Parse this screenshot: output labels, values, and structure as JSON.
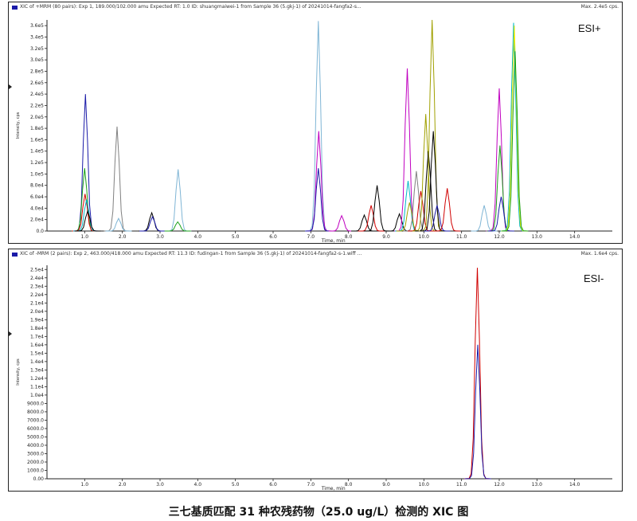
{
  "caption": "三七基质匹配 31 种农残药物（25.0 ug/L）检测的 XIC 图",
  "colors": {
    "axis": "#222222",
    "palette": [
      "#1a1aa8",
      "#d00000",
      "#18a018",
      "#00b7c8",
      "#c000c0",
      "#808080",
      "#000000",
      "#a0a000",
      "#7fb5d5",
      "#e8e800",
      "#5050ff",
      "#ff66cc"
    ]
  },
  "chart_data": [
    {
      "type": "line",
      "header": "XIC of +MRM (80 pairs): Exp 1, 189.000/102.000 amu Expected RT: 1.0 ID: shuangmaiwei-1 from Sample 36 (5.gkj-1) of 20241014-fangfa2-s...",
      "max_label": "Max. 2.4e5 cps.",
      "mode_label": "ESI+",
      "xlabel": "Time, min",
      "ylabel": "Intensity, cps",
      "xlim": [
        0,
        15.0
      ],
      "ylim": [
        0,
        370000
      ],
      "x_ticks": [
        1.0,
        2.0,
        3.0,
        4.0,
        5.0,
        6.0,
        7.0,
        8.0,
        9.0,
        10.0,
        11.0,
        12.0,
        13.0,
        14.0
      ],
      "x_tick_labels": [
        "1.0",
        "2.0",
        "3.0",
        "4.0",
        "5.0",
        "6.0",
        "7.0",
        "8.0",
        "9.0",
        "10.0",
        "11.0",
        "12.0",
        "13.0",
        "14.0"
      ],
      "y_ticks": [
        0,
        20000,
        40000,
        60000,
        80000,
        100000,
        120000,
        140000,
        160000,
        180000,
        200000,
        220000,
        240000,
        260000,
        280000,
        300000,
        320000,
        340000,
        360000
      ],
      "y_tick_labels": [
        "0.0",
        "2.0e4",
        "4.0e4",
        "6.0e4",
        "8.0e4",
        "1.0e5",
        "1.2e5",
        "1.4e5",
        "1.6e5",
        "1.8e5",
        "2.0e5",
        "2.2e5",
        "2.4e5",
        "2.6e5",
        "2.8e5",
        "3.0e5",
        "3.2e5",
        "3.4e5",
        "3.6e5"
      ],
      "peaks": [
        {
          "rt": 1.02,
          "height": 240000,
          "color": 0
        },
        {
          "rt": 1.0,
          "height": 110000,
          "color": 2
        },
        {
          "rt": 1.01,
          "height": 65000,
          "color": 1
        },
        {
          "rt": 1.05,
          "height": 55000,
          "color": 3
        },
        {
          "rt": 1.08,
          "height": 35000,
          "color": 6
        },
        {
          "rt": 1.86,
          "height": 183000,
          "color": 5
        },
        {
          "rt": 1.9,
          "height": 22000,
          "color": 8
        },
        {
          "rt": 2.78,
          "height": 32000,
          "color": 6
        },
        {
          "rt": 2.8,
          "height": 25000,
          "color": 0
        },
        {
          "rt": 3.48,
          "height": 108000,
          "color": 8
        },
        {
          "rt": 3.47,
          "height": 16000,
          "color": 2
        },
        {
          "rt": 7.2,
          "height": 368000,
          "color": 8
        },
        {
          "rt": 7.21,
          "height": 175000,
          "color": 4
        },
        {
          "rt": 7.2,
          "height": 110000,
          "color": 0
        },
        {
          "rt": 7.82,
          "height": 27000,
          "color": 4
        },
        {
          "rt": 8.42,
          "height": 28000,
          "color": 6
        },
        {
          "rt": 8.6,
          "height": 45000,
          "color": 1
        },
        {
          "rt": 8.76,
          "height": 80000,
          "color": 6
        },
        {
          "rt": 9.35,
          "height": 30000,
          "color": 6
        },
        {
          "rt": 9.56,
          "height": 285000,
          "color": 4
        },
        {
          "rt": 9.58,
          "height": 88000,
          "color": 3
        },
        {
          "rt": 9.62,
          "height": 50000,
          "color": 7
        },
        {
          "rt": 9.8,
          "height": 105000,
          "color": 5
        },
        {
          "rt": 9.92,
          "height": 70000,
          "color": 1
        },
        {
          "rt": 10.05,
          "height": 205000,
          "color": 7
        },
        {
          "rt": 10.12,
          "height": 140000,
          "color": 6
        },
        {
          "rt": 10.22,
          "height": 370000,
          "color": 7
        },
        {
          "rt": 10.25,
          "height": 175000,
          "color": 6
        },
        {
          "rt": 10.35,
          "height": 45000,
          "color": 0
        },
        {
          "rt": 10.62,
          "height": 75000,
          "color": 1
        },
        {
          "rt": 11.6,
          "height": 45000,
          "color": 8
        },
        {
          "rt": 12.0,
          "height": 250000,
          "color": 4
        },
        {
          "rt": 12.02,
          "height": 150000,
          "color": 2
        },
        {
          "rt": 12.05,
          "height": 60000,
          "color": 0
        },
        {
          "rt": 12.38,
          "height": 365000,
          "color": 3
        },
        {
          "rt": 12.4,
          "height": 360000,
          "color": 9
        },
        {
          "rt": 12.42,
          "height": 315000,
          "color": 2
        }
      ]
    },
    {
      "type": "line",
      "header": "XIC of -MRM (2 pairs): Exp 2, 463.000/418.000 amu Expected RT: 11.3 ID: fudingan-1 from Sample 36 (5.gkj-1) of 20241014-fangfa2-s-1.wiff ...",
      "max_label": "Max. 1.6e4 cps.",
      "mode_label": "ESI-",
      "xlabel": "Time, min",
      "ylabel": "Intensity, cps",
      "xlim": [
        0,
        15.0
      ],
      "ylim": [
        0,
        25500
      ],
      "x_ticks": [
        1.0,
        2.0,
        3.0,
        4.0,
        5.0,
        6.0,
        7.0,
        8.0,
        9.0,
        10.0,
        11.0,
        12.0,
        13.0,
        14.0
      ],
      "x_tick_labels": [
        "1.0",
        "2.0",
        "3.0",
        "4.0",
        "5.0",
        "6.0",
        "7.0",
        "8.0",
        "9.0",
        "10.0",
        "11.0",
        "12.0",
        "13.0",
        "14.0"
      ],
      "y_ticks": [
        0,
        1000,
        2000,
        3000,
        4000,
        5000,
        6000,
        7000,
        8000,
        9000,
        10000,
        11000,
        12000,
        13000,
        14000,
        15000,
        16000,
        17000,
        18000,
        19000,
        20000,
        21000,
        22000,
        23000,
        24000,
        25000
      ],
      "y_tick_labels": [
        "0.00",
        "1000.0",
        "2000.0",
        "3000.0",
        "4000.0",
        "5000.0",
        "6000.0",
        "7000.0",
        "8000.0",
        "9000.0",
        "1.0e4",
        "1.1e4",
        "1.2e4",
        "1.3e4",
        "1.4e4",
        "1.5e4",
        "1.6e4",
        "1.7e4",
        "1.8e4",
        "1.9e4",
        "2.0e4",
        "2.1e4",
        "2.2e4",
        "2.3e4",
        "2.4e4",
        "2.5e4"
      ],
      "peaks": [
        {
          "rt": 11.42,
          "height": 25200,
          "color": 1
        },
        {
          "rt": 11.43,
          "height": 16000,
          "color": 0
        }
      ]
    }
  ]
}
